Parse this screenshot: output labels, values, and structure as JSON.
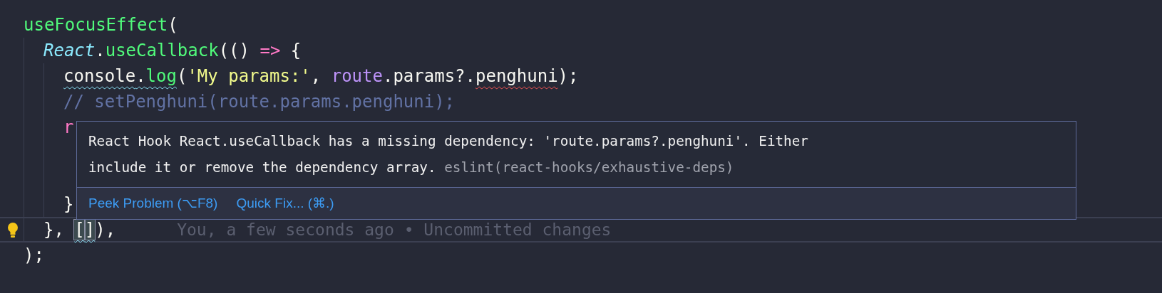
{
  "editor": {
    "lines": [
      {
        "current": false,
        "lightbulb": false,
        "tokens": [
          {
            "text": "useFocusEffect",
            "kind": "function",
            "matched": false
          },
          {
            "text": "(",
            "kind": "plain",
            "matched": false
          }
        ],
        "children": [
          {
            "current": false,
            "lightbulb": false,
            "tokens": [
              {
                "text": "React",
                "kind": "class",
                "matched": false
              },
              {
                "text": ".",
                "kind": "plain",
                "matched": false
              },
              {
                "text": "useCallback",
                "kind": "function",
                "matched": false
              },
              {
                "text": "(() ",
                "kind": "plain",
                "matched": false
              },
              {
                "text": "=>",
                "kind": "keyword",
                "matched": false
              },
              {
                "text": " {",
                "kind": "plain",
                "matched": false
              }
            ],
            "children": [
              {
                "current": false,
                "lightbulb": false,
                "tokens": [
                  {
                    "text": "console",
                    "kind": "plain",
                    "matched": false,
                    "squiggle": {
                      "kind": "info"
                    }
                  },
                  {
                    "text": ".",
                    "kind": "plain",
                    "matched": false,
                    "squiggle": {
                      "kind": "info"
                    }
                  },
                  {
                    "text": "log",
                    "kind": "function",
                    "matched": false,
                    "squiggle": {
                      "kind": "info"
                    }
                  },
                  {
                    "text": "(",
                    "kind": "plain",
                    "matched": false
                  },
                  {
                    "text": "'My params:'",
                    "kind": "string",
                    "matched": false
                  },
                  {
                    "text": ", ",
                    "kind": "plain",
                    "matched": false
                  },
                  {
                    "text": "route",
                    "kind": "variable",
                    "matched": false
                  },
                  {
                    "text": ".params?.",
                    "kind": "plain",
                    "matched": false
                  },
                  {
                    "text": "penghuni",
                    "kind": "plain",
                    "matched": false,
                    "squiggle": {
                      "kind": "error"
                    }
                  },
                  {
                    "text": ");",
                    "kind": "plain",
                    "matched": false
                  }
                ]
              },
              {
                "current": false,
                "lightbulb": false,
                "tokens": [
                  {
                    "text": "// setPenghuni(route.params.penghuni);",
                    "kind": "comment",
                    "matched": false
                  }
                ]
              },
              {
                "current": false,
                "lightbulb": false,
                "tokens": [
                  {
                    "text": "r",
                    "kind": "keyword",
                    "matched": false
                  }
                ]
              },
              {
                "current": false,
                "lightbulb": false,
                "tokens": [
                  {
                    "text": "}",
                    "kind": "plain",
                    "matched": false
                  }
                ]
              }
            ]
          },
          {
            "current": true,
            "lightbulb": true,
            "blame": "You, a few seconds ago • Uncommitted changes",
            "tokens": [
              {
                "text": "}, ",
                "kind": "plain",
                "matched": false
              },
              {
                "text": "[",
                "kind": "plain",
                "matched": true,
                "squiggle": {
                  "kind": "info"
                }
              },
              {
                "text": "]",
                "kind": "plain",
                "matched": true,
                "squiggle": {
                  "kind": "info"
                }
              },
              {
                "text": "),",
                "kind": "plain",
                "matched": false
              }
            ]
          }
        ]
      },
      {
        "current": false,
        "lightbulb": false,
        "tokens": [
          {
            "text": ");",
            "kind": "plain",
            "matched": false
          }
        ]
      }
    ]
  },
  "hover": {
    "message": "React Hook React.useCallback has a missing dependency: 'route.params?.penghuni'. Either include it or remove the dependency array.",
    "source": "eslint(react-hooks/exhaustive-deps)",
    "actions": [
      "Peek Problem (⌥F8)",
      "Quick Fix... (⌘.)"
    ]
  }
}
